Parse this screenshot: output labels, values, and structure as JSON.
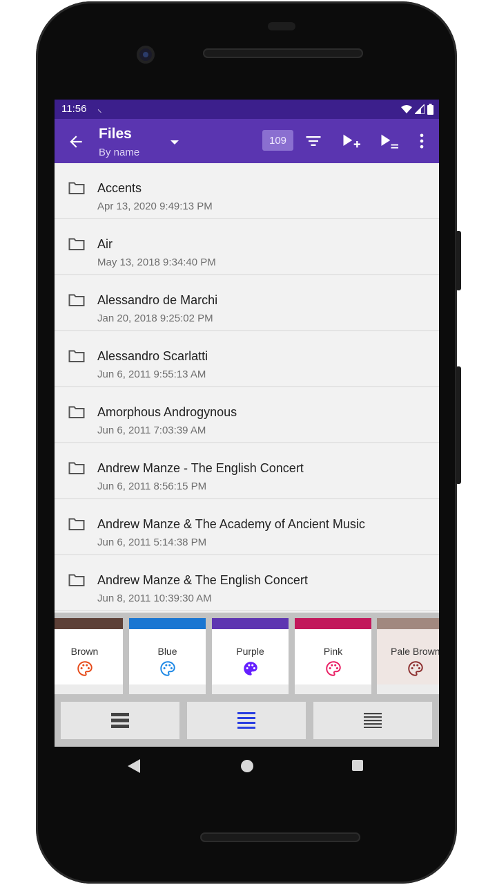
{
  "status_bar": {
    "time": "11:56",
    "extra_icon": "⸜"
  },
  "app_bar": {
    "title": "Files",
    "subtitle": "By name",
    "count": "109",
    "icons": [
      "back-arrow-icon",
      "dropdown-icon",
      "filter-icon",
      "play-add-icon",
      "play-queue-icon",
      "more-vert-icon"
    ]
  },
  "files": [
    {
      "name": "Accents",
      "date": "Apr 13, 2020 9:49:13 PM"
    },
    {
      "name": "Air",
      "date": "May 13, 2018 9:34:40 PM"
    },
    {
      "name": "Alessandro de Marchi",
      "date": "Jan 20, 2018 9:25:02 PM"
    },
    {
      "name": "Alessandro Scarlatti",
      "date": "Jun 6, 2011 9:55:13 AM"
    },
    {
      "name": "Amorphous Androgynous",
      "date": "Jun 6, 2011 7:03:39 AM"
    },
    {
      "name": "Andrew Manze - The English Concert",
      "date": "Jun 6, 2011 8:56:15 PM"
    },
    {
      "name": "Andrew Manze & The Academy of Ancient Music",
      "date": "Jun 6, 2011 5:14:38 PM"
    },
    {
      "name": "Andrew Manze & The English Concert",
      "date": "Jun 8, 2011 10:39:30 AM"
    }
  ],
  "themes": [
    {
      "label": "Brown",
      "band": "#5d4037",
      "icon_color": "#e64a19",
      "bg": "#ffffff"
    },
    {
      "label": "Blue",
      "band": "#1976d2",
      "icon_color": "#1e88e5",
      "bg": "#ffffff"
    },
    {
      "label": "Purple",
      "band": "#5e35b1",
      "icon_color": "#651fff",
      "bg": "#ffffff"
    },
    {
      "label": "Pink",
      "band": "#c2185b",
      "icon_color": "#e91e63",
      "bg": "#ffffff"
    },
    {
      "label": "Pale Brown",
      "band": "#a1887f",
      "icon_color": "#8d2f2f",
      "bg": "#efe6e3"
    }
  ],
  "bottom_buttons": [
    {
      "name": "list-style-1",
      "color": "#444444"
    },
    {
      "name": "list-style-2",
      "color": "#2a3fe0"
    },
    {
      "name": "list-style-3",
      "color": "#444444"
    }
  ]
}
